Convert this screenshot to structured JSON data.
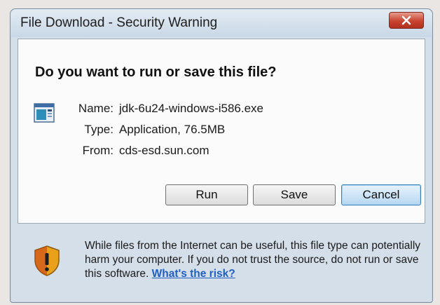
{
  "window": {
    "title": "File Download - Security Warning"
  },
  "dialog": {
    "heading": "Do you want to run or save this file?",
    "file": {
      "name_label": "Name:",
      "name_value": "jdk-6u24-windows-i586.exe",
      "type_label": "Type:",
      "type_value": "Application, 76.5MB",
      "from_label": "From:",
      "from_value": "cds-esd.sun.com"
    },
    "buttons": {
      "run": "Run",
      "save": "Save",
      "cancel": "Cancel"
    },
    "warning": {
      "text": "While files from the Internet can be useful, this file type can potentially harm your computer. If you do not trust the source, do not run or save this software. ",
      "link": "What's the risk?"
    }
  },
  "icons": {
    "close": "close-icon",
    "file": "application-file-icon",
    "shield": "shield-warning-icon"
  },
  "colors": {
    "close_button": "#c8432f",
    "link": "#1f5fc4",
    "default_button_border": "#3c7fb1"
  }
}
